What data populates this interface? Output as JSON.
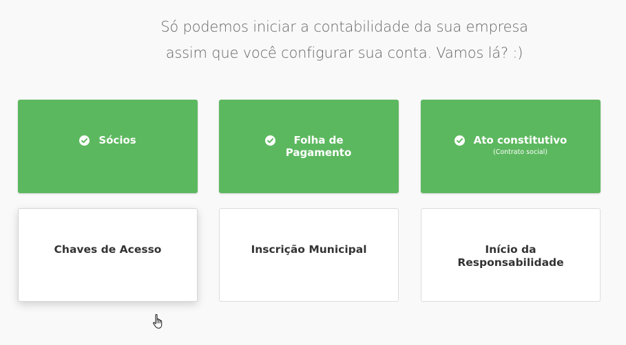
{
  "intro": {
    "line1": "Só podemos iniciar a contabilidade da sua empresa",
    "line2": "assim que você configurar sua conta. Vamos lá? :)"
  },
  "cards": [
    {
      "title": "Sócios",
      "subtitle": "",
      "status": "done"
    },
    {
      "title": "Folha de Pagamento",
      "subtitle": "",
      "status": "done"
    },
    {
      "title": "Ato constitutivo",
      "subtitle": "(Contrato social)",
      "status": "done"
    },
    {
      "title": "Chaves de Acesso",
      "status": "pending"
    },
    {
      "title": "Inscrição Municipal",
      "status": "pending"
    },
    {
      "title": "Início da Responsabilidade",
      "status": "pending"
    }
  ],
  "colors": {
    "done": "#5cb85f",
    "pending": "#ffffff",
    "text_muted": "#666666",
    "text_dark": "#333333"
  },
  "icons": {
    "check": "check-circle-icon",
    "cursor": "hand-pointer-icon"
  }
}
